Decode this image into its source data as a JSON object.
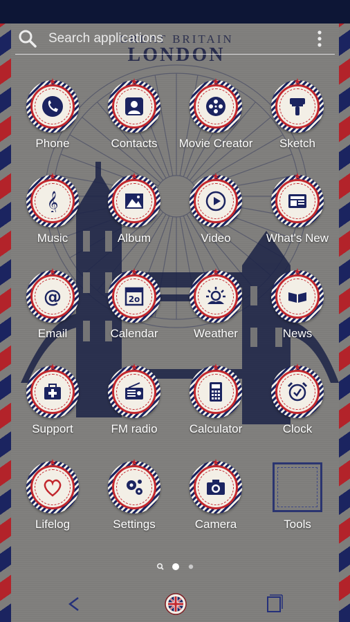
{
  "search": {
    "placeholder": "Search applications"
  },
  "wallpaper": {
    "header_line1": "GREAT BRITAIN",
    "header_line2": "LONDON"
  },
  "theme": {
    "navy": "#1b2460",
    "red": "#c2272d",
    "cream": "#f3efe6",
    "paper_gray": "#7e7d7b"
  },
  "apps": [
    {
      "label": "Phone",
      "icon": "phone-icon"
    },
    {
      "label": "Contacts",
      "icon": "contact-icon"
    },
    {
      "label": "Movie Creator",
      "icon": "film-reel-icon"
    },
    {
      "label": "Sketch",
      "icon": "brush-icon"
    },
    {
      "label": "Music",
      "icon": "treble-clef-icon"
    },
    {
      "label": "Album",
      "icon": "mountain-photo-icon"
    },
    {
      "label": "Video",
      "icon": "play-icon"
    },
    {
      "label": "What's New",
      "icon": "news-card-icon"
    },
    {
      "label": "Email",
      "icon": "at-sign-icon"
    },
    {
      "label": "Calendar",
      "icon": "calendar-icon"
    },
    {
      "label": "Weather",
      "icon": "sun-cloud-icon"
    },
    {
      "label": "News",
      "icon": "open-book-icon"
    },
    {
      "label": "Support",
      "icon": "first-aid-icon"
    },
    {
      "label": "FM radio",
      "icon": "radio-icon"
    },
    {
      "label": "Calculator",
      "icon": "calculator-icon"
    },
    {
      "label": "Clock",
      "icon": "alarm-clock-icon"
    },
    {
      "label": "Lifelog",
      "icon": "heart-icon"
    },
    {
      "label": "Settings",
      "icon": "gears-icon"
    },
    {
      "label": "Camera",
      "icon": "camera-icon"
    },
    {
      "label": "Tools",
      "icon": "folder-frame-icon"
    }
  ],
  "calendar_icon_text": "2o",
  "pager": {
    "pages": 2,
    "current": 1
  },
  "navbar": {
    "back": "back-icon",
    "home": "union-jack-home-icon",
    "recents": "recents-icon"
  }
}
